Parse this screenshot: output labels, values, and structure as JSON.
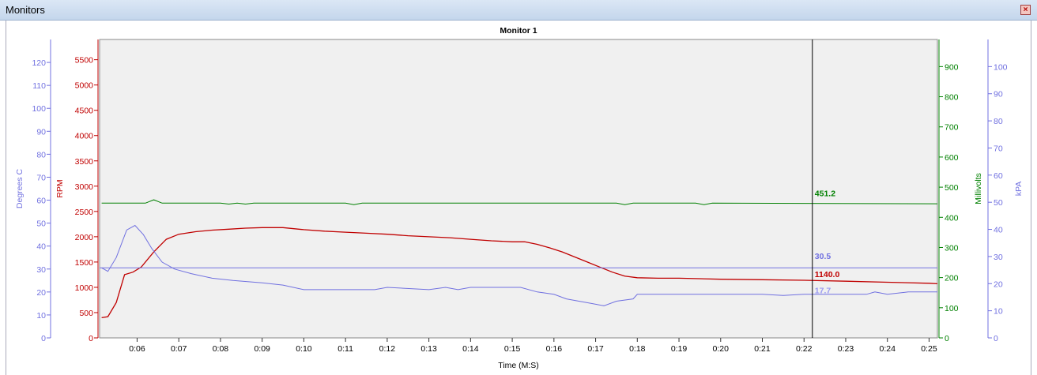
{
  "window": {
    "title": "Monitors",
    "close_icon": "close-icon"
  },
  "colors": {
    "plot_bg": "#f0f0f0",
    "red": "#c00000",
    "green": "#008000",
    "blue": "#7070e0",
    "cursor": "#000000"
  },
  "chart_data": {
    "type": "line",
    "title": "Monitor 1",
    "xlabel": "Time (M:S)",
    "x_ticks": [
      "0:06",
      "0:07",
      "0:08",
      "0:09",
      "0:10",
      "0:11",
      "0:12",
      "0:13",
      "0:14",
      "0:15",
      "0:16",
      "0:17",
      "0:18",
      "0:19",
      "0:20",
      "0:21",
      "0:22",
      "0:23",
      "0:24",
      "0:25"
    ],
    "xlim": [
      5.1,
      25.2
    ],
    "axes": {
      "degrees": {
        "label": "Degrees C",
        "ticks": [
          0,
          10,
          20,
          30,
          40,
          50,
          60,
          70,
          80,
          90,
          100,
          110,
          120
        ],
        "ylim": [
          0,
          130
        ]
      },
      "rpm": {
        "label": "RPM",
        "ticks": [
          0,
          500,
          1000,
          1500,
          2000,
          2500,
          3000,
          3500,
          4000,
          4500,
          5000,
          5500
        ],
        "ylim": [
          0,
          5900
        ]
      },
      "mv": {
        "label": "Millivolts",
        "ticks": [
          0,
          100,
          200,
          300,
          400,
          500,
          600,
          700,
          800,
          900
        ],
        "ylim": [
          0,
          990
        ]
      },
      "kpa": {
        "label": "kPA",
        "ticks": [
          0,
          10,
          20,
          30,
          40,
          50,
          60,
          70,
          80,
          90,
          100
        ],
        "ylim": [
          0,
          110
        ]
      }
    },
    "series": [
      {
        "axis": "rpm",
        "color": "#c00000",
        "x": [
          5.15,
          5.3,
          5.5,
          5.7,
          5.9,
          6.1,
          6.4,
          6.7,
          7.0,
          7.4,
          7.8,
          8.2,
          8.6,
          9.0,
          9.5,
          10.0,
          10.5,
          11.0,
          11.5,
          12.0,
          12.5,
          13.0,
          13.5,
          14.0,
          14.5,
          15.0,
          15.3,
          15.6,
          15.9,
          16.2,
          16.5,
          16.8,
          17.1,
          17.4,
          17.7,
          18.0,
          18.5,
          19.0,
          19.5,
          20.0,
          21.0,
          22.0,
          23.0,
          24.0,
          25.0,
          25.2
        ],
        "values": [
          400,
          420,
          700,
          1250,
          1300,
          1400,
          1700,
          1950,
          2050,
          2100,
          2130,
          2150,
          2170,
          2180,
          2180,
          2140,
          2110,
          2090,
          2070,
          2050,
          2020,
          2000,
          1980,
          1950,
          1920,
          1900,
          1900,
          1850,
          1780,
          1700,
          1600,
          1500,
          1400,
          1300,
          1220,
          1190,
          1180,
          1180,
          1170,
          1160,
          1150,
          1140,
          1120,
          1100,
          1080,
          1070
        ]
      },
      {
        "axis": "mv",
        "color": "#008000",
        "x": [
          5.15,
          6.2,
          6.4,
          6.6,
          8.0,
          8.2,
          8.4,
          8.6,
          8.8,
          11.0,
          11.2,
          11.4,
          17.5,
          17.7,
          17.9,
          19.4,
          19.6,
          19.8,
          25.2
        ],
        "values": [
          447,
          447,
          458,
          447,
          447,
          444,
          447,
          444,
          447,
          447,
          442,
          447,
          447,
          442,
          447,
          447,
          442,
          447,
          445
        ]
      },
      {
        "axis": "degrees",
        "color": "#7070e0",
        "name": "30.5",
        "x": [
          5.1,
          25.2
        ],
        "values": [
          30.5,
          30.5
        ]
      },
      {
        "axis": "degrees",
        "color": "#7070e0",
        "x": [
          5.15,
          5.3,
          5.5,
          5.75,
          5.95,
          6.15,
          6.35,
          6.6,
          6.9,
          7.3,
          7.8,
          8.3,
          9.0,
          9.5,
          10.0,
          11.0,
          11.7,
          12.0,
          13.0,
          13.4,
          13.7,
          14.0,
          14.5,
          15.2,
          15.6,
          16.0,
          16.3,
          16.6,
          16.9,
          17.2,
          17.5,
          17.9,
          18.0,
          18.5,
          19.0,
          20.0,
          21.0,
          21.5,
          22.0,
          22.5,
          23.0,
          23.5,
          23.7,
          24.0,
          24.5,
          25.2
        ],
        "values": [
          30.5,
          29,
          35,
          47,
          49,
          45,
          39,
          33,
          30,
          28,
          26,
          25,
          24,
          23,
          21,
          21,
          21,
          22,
          21,
          22,
          21,
          22,
          22,
          22,
          20,
          19,
          17,
          16,
          15,
          14,
          16,
          17,
          19,
          19,
          19,
          19,
          19,
          18.5,
          19,
          19,
          19,
          19,
          20,
          19,
          20,
          20
        ]
      }
    ],
    "cursor": {
      "x": 22.2,
      "labels": [
        {
          "text": "451.2",
          "color": "#008000",
          "axis": "mv",
          "value": 460
        },
        {
          "text": "30.5",
          "color": "#7070e0",
          "axis": "degrees",
          "value": 33
        },
        {
          "text": "1140.0",
          "color": "#c00000",
          "axis": "rpm",
          "value": 1140
        },
        {
          "text": "17.7",
          "color": "#9b9bf2",
          "axis": "degrees",
          "value": 18
        }
      ]
    }
  }
}
